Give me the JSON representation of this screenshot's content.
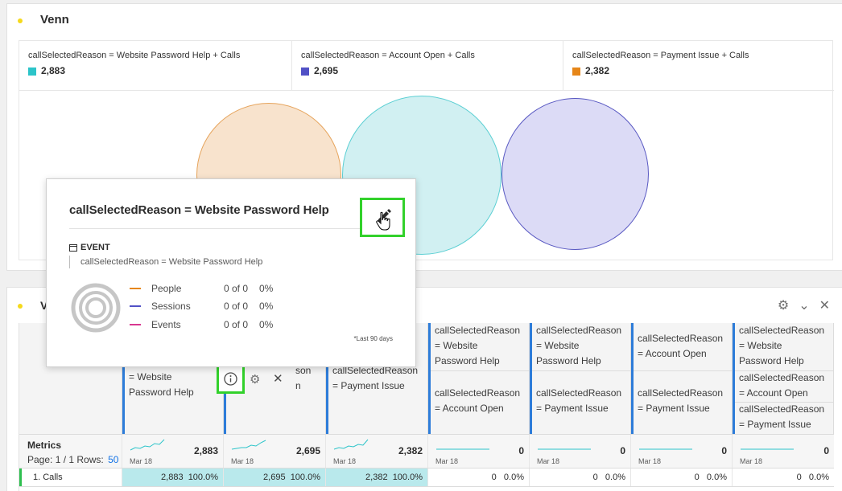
{
  "venn": {
    "title": "Venn",
    "legend": [
      {
        "label": "callSelectedReason = Website Password Help + Calls",
        "value": "2,883",
        "color": "#2cc4c9"
      },
      {
        "label": "callSelectedReason = Account Open + Calls",
        "value": "2,695",
        "color": "#5151c6"
      },
      {
        "label": "callSelectedReason = Payment Issue + Calls",
        "value": "2,382",
        "color": "#e68619"
      }
    ]
  },
  "table": {
    "title_prefix": "V",
    "columns": [
      {
        "lines": [
          "= Website",
          "Password Help"
        ]
      },
      {
        "lines": [
          "son",
          "n"
        ]
      },
      {
        "lines": [
          "callSelectedReason",
          "= Payment Issue"
        ]
      },
      {
        "top": [
          "callSelectedReason",
          "= Website",
          "Password Help"
        ],
        "bottom": [
          "callSelectedReason",
          "= Account Open"
        ]
      },
      {
        "top": [
          "callSelectedReason",
          "= Website",
          "Password Help"
        ],
        "bottom": [
          "callSelectedReason",
          "= Payment Issue"
        ]
      },
      {
        "top": [
          "callSelectedReason",
          "= Account Open"
        ],
        "bottom": [
          "callSelectedReason",
          "= Payment Issue"
        ]
      },
      {
        "top": [
          "callSelectedReason",
          "= Website",
          "Password Help"
        ],
        "mid": [
          "callSelectedReason",
          "= Account Open"
        ],
        "bottom": [
          "callSelectedReason",
          "= Payment Issue"
        ]
      }
    ],
    "metrics_label": "Metrics",
    "pagination": "Page: 1 / 1 Rows:",
    "rows_value": "50",
    "spark_date": "Mar 18",
    "totals": [
      "2,883",
      "2,695",
      "2,382",
      "0",
      "0",
      "0",
      "0"
    ],
    "row": {
      "label": "1. Calls",
      "values": [
        "2,883",
        "2,695",
        "2,382",
        "0",
        "0",
        "0",
        "0"
      ],
      "percents": [
        "100.0%",
        "100.0%",
        "100.0%",
        "0.0%",
        "0.0%",
        "0.0%",
        "0.0%"
      ]
    }
  },
  "popover": {
    "title": "callSelectedReason = Website Password Help",
    "event_label": "EVENT",
    "event_desc": "callSelectedReason = Website Password Help",
    "stats": [
      {
        "name": "People",
        "count": "0 of 0",
        "pct": "0%",
        "color": "#e68619"
      },
      {
        "name": "Sessions",
        "count": "0 of 0",
        "pct": "0%",
        "color": "#5151c6"
      },
      {
        "name": "Events",
        "count": "0 of 0",
        "pct": "0%",
        "color": "#d83790"
      }
    ],
    "footnote": "*Last 90 days"
  }
}
